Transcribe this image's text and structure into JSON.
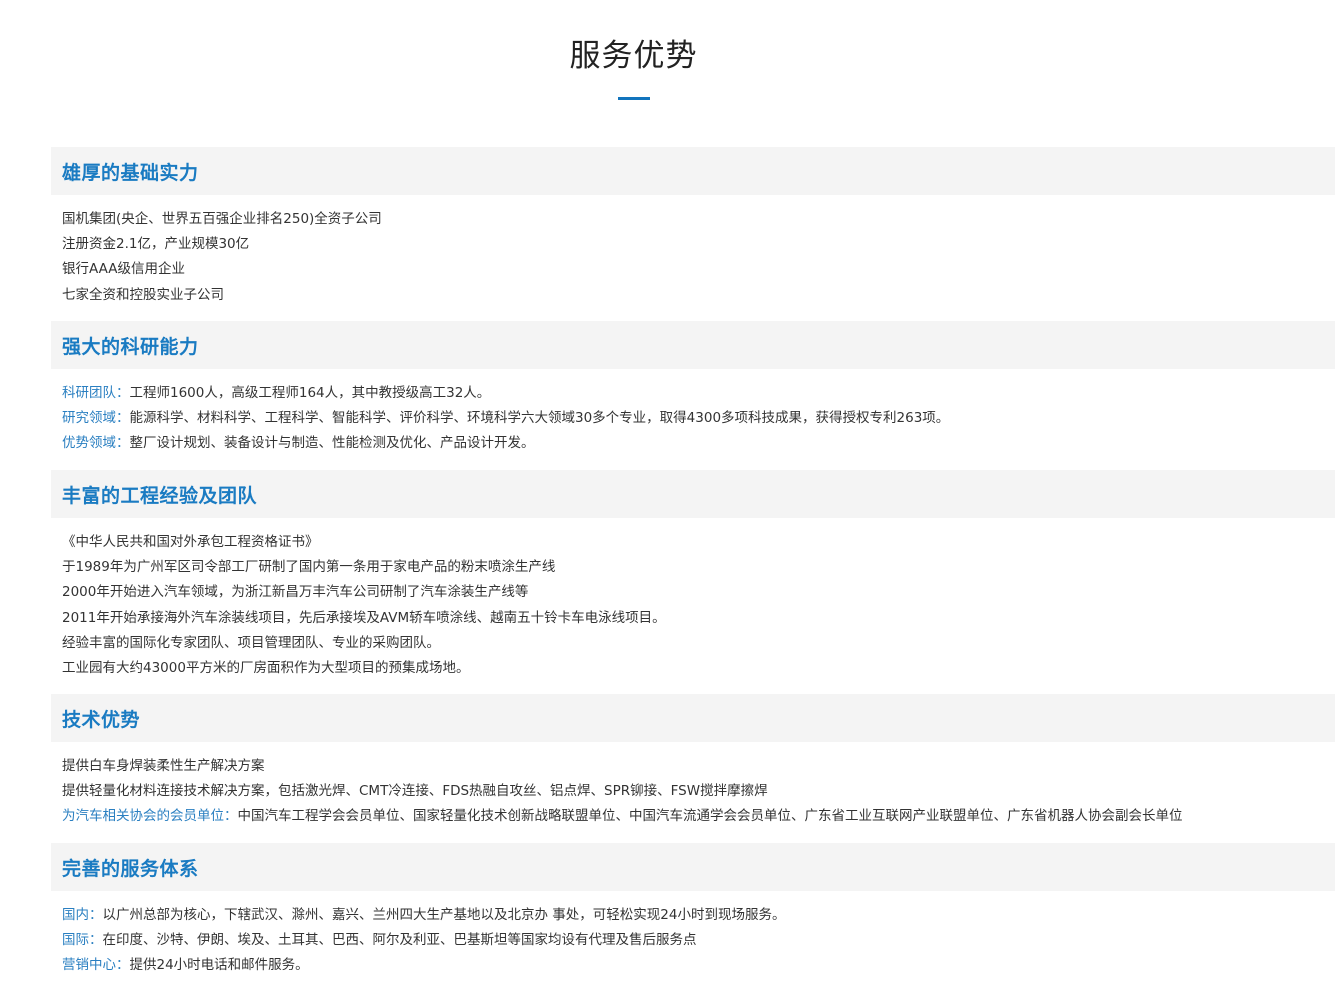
{
  "page": {
    "title": "服务优势"
  },
  "sections": [
    {
      "title": "雄厚的基础实力",
      "lines": [
        {
          "label": "",
          "text": "国机集团(央企、世界五百强企业排名250)全资子公司"
        },
        {
          "label": "",
          "text": "注册资金2.1亿，产业规模30亿"
        },
        {
          "label": "",
          "text": "银行AAA级信用企业"
        },
        {
          "label": "",
          "text": "七家全资和控股实业子公司"
        }
      ]
    },
    {
      "title": "强大的科研能力",
      "lines": [
        {
          "label": "科研团队：",
          "text": "工程师1600人，高级工程师164人，其中教授级高工32人。"
        },
        {
          "label": "研究领域：",
          "text": "能源科学、材料科学、工程科学、智能科学、评价科学、环境科学六大领域30多个专业，取得4300多项科技成果，获得授权专利263项。"
        },
        {
          "label": "优势领域：",
          "text": "整厂设计规划、装备设计与制造、性能检测及优化、产品设计开发。"
        }
      ]
    },
    {
      "title": "丰富的工程经验及团队",
      "lines": [
        {
          "label": "",
          "text": "《中华人民共和国对外承包工程资格证书》"
        },
        {
          "label": "",
          "text": "于1989年为广州军区司令部工厂研制了国内第一条用于家电产品的粉末喷涂生产线"
        },
        {
          "label": "",
          "text": "2000年开始进入汽车领域，为浙江新昌万丰汽车公司研制了汽车涂装生产线等"
        },
        {
          "label": "",
          "text": "2011年开始承接海外汽车涂装线项目，先后承接埃及AVM轿车喷涂线、越南五十铃卡车电泳线项目。"
        },
        {
          "label": "",
          "text": "经验丰富的国际化专家团队、项目管理团队、专业的采购团队。"
        },
        {
          "label": "",
          "text": "工业园有大约43000平方米的厂房面积作为大型项目的预集成场地。"
        }
      ]
    },
    {
      "title": "技术优势",
      "lines": [
        {
          "label": "",
          "text": "提供白车身焊装柔性生产解决方案"
        },
        {
          "label": "",
          "text": "提供轻量化材料连接技术解决方案，包括激光焊、CMT冷连接、FDS热融自攻丝、铝点焊、SPR铆接、FSW搅拌摩擦焊"
        },
        {
          "label": "为汽车相关协会的会员单位：",
          "text": "中国汽车工程学会会员单位、国家轻量化技术创新战略联盟单位、中国汽车流通学会会员单位、广东省工业互联网产业联盟单位、广东省机器人协会副会长单位"
        }
      ]
    },
    {
      "title": "完善的服务体系",
      "lines": [
        {
          "label": "国内：",
          "text": "以广州总部为核心，下辖武汉、滁州、嘉兴、兰州四大生产基地以及北京办 事处，可轻松实现24小时到现场服务。"
        },
        {
          "label": "国际：",
          "text": "在印度、沙特、伊朗、埃及、土耳其、巴西、阿尔及利亚、巴基斯坦等国家均设有代理及售后服务点"
        },
        {
          "label": "营销中心：",
          "text": "提供24小时电话和邮件服务。"
        }
      ]
    }
  ]
}
